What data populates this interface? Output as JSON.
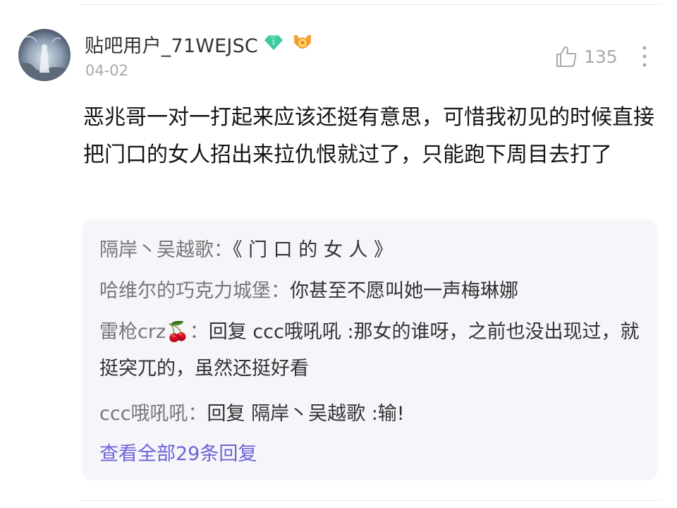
{
  "comment": {
    "username": "贴吧用户_71WEJSC",
    "level_badge": "1",
    "date": "04-02",
    "like_count": "135",
    "text": "恶兆哥一对一打起来应该还挺有意思，可惜我初见的时候直接把门口的女人招出来拉仇恨就过了，只能跑下周目去打了",
    "icons": {
      "avatar": "avatar-image",
      "level": "diamond-level-icon",
      "medal": "orange-medal-icon",
      "like": "thumbs-up-icon",
      "more": "more-vertical-icon"
    }
  },
  "replies": {
    "items": [
      {
        "name": "隔岸丶吴越歌",
        "colon": "：",
        "text": "《 门 口 的 女 人 》"
      },
      {
        "name": "哈维尔的巧克力城堡",
        "colon": "：",
        "text": "你甚至不愿叫她一声梅琳娜"
      },
      {
        "name": "雷枪crz",
        "emoji": "🍒",
        "colon": "：",
        "text": "回复 ccc哦吼吼 :那女的谁呀，之前也没出现过，就挺突兀的，虽然还挺好看"
      },
      {
        "name": "ccc哦吼吼",
        "colon": "：",
        "text": "回复 隔岸丶吴越歌 :输!"
      }
    ],
    "view_all": "查看全部29条回复"
  },
  "colors": {
    "link": "#6c64d6",
    "badge_green": "#3ec9a0",
    "medal_orange": "#f5a33a",
    "panel_bg": "#f5f5fa"
  }
}
